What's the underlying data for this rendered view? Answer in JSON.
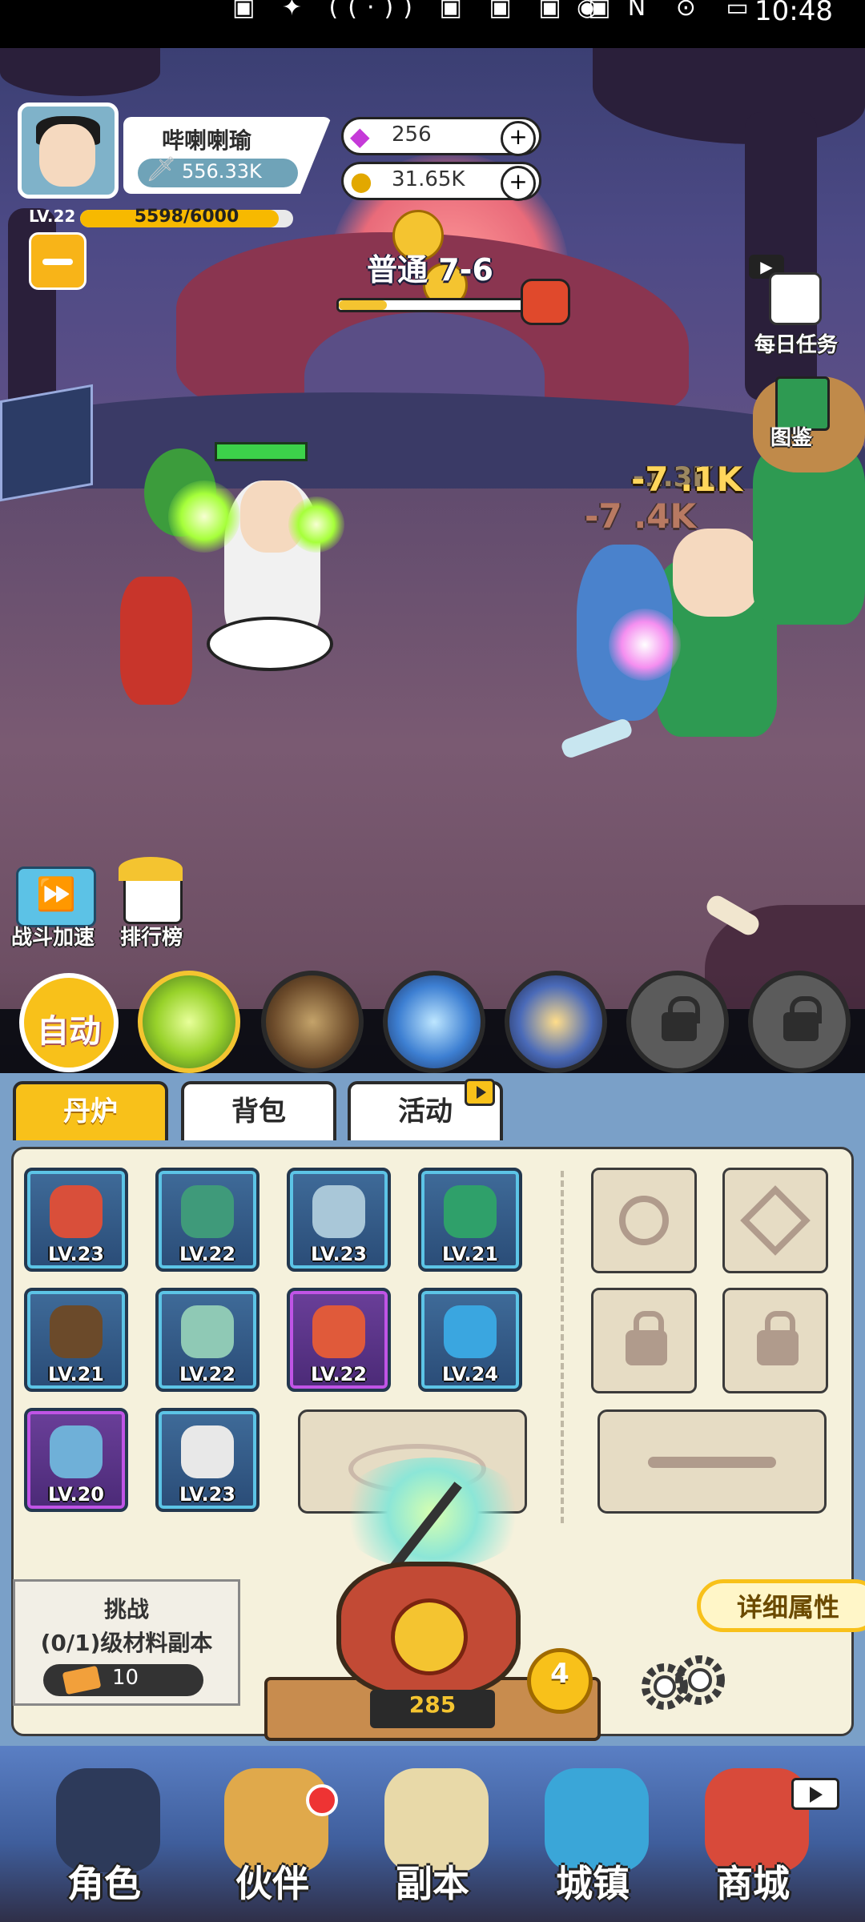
{
  "status_bar": {
    "time": "10:48",
    "left_icons": "▣ ✦ ((·)) ▣ ▣ ▣ ▣",
    "right_icons": "◉ N ⊙ ▭"
  },
  "player": {
    "name": "哔喇喇瑜",
    "power": "556.33K",
    "level": "LV.22",
    "xp": "5598/6000",
    "xp_fraction": 0.933
  },
  "currency": {
    "gems": "256",
    "coins": "31.65K",
    "plus": "+"
  },
  "stage": {
    "label": "普通 7-6",
    "progress_fraction": 0.25
  },
  "battle": {
    "damage_1": "-7 .1K",
    "damage_2": "-7 .4K",
    "damage_3": "-1.3K"
  },
  "side_buttons": {
    "daily_task": "每日任务",
    "codex": "图鉴",
    "battle_speed": "战斗加速",
    "leaderboard": "排行榜"
  },
  "skills": {
    "auto": "自动"
  },
  "tabs": [
    "丹炉",
    "背包",
    "活动"
  ],
  "equipment": [
    {
      "level": "LV.23",
      "rarity": "blue",
      "icon": "dagger-icon",
      "color": "#d94f3a"
    },
    {
      "level": "LV.22",
      "rarity": "blue",
      "icon": "armor-icon",
      "color": "#3f9a7a"
    },
    {
      "level": "LV.23",
      "rarity": "blue",
      "icon": "robe-icon",
      "color": "#a9c7d8"
    },
    {
      "level": "LV.21",
      "rarity": "blue",
      "icon": "dragon-orb-icon",
      "color": "#2fa06a"
    },
    {
      "level": "LV.21",
      "rarity": "blue",
      "icon": "staff-icon",
      "color": "#6b4a2a"
    },
    {
      "level": "LV.22",
      "rarity": "blue",
      "icon": "jade-disc-icon",
      "color": "#8fc9b5"
    },
    {
      "level": "LV.22",
      "rarity": "purple",
      "icon": "gourd-icon",
      "color": "#e05a3a"
    },
    {
      "level": "LV.24",
      "rarity": "blue",
      "icon": "water-orb-icon",
      "color": "#3aa6e0"
    },
    {
      "level": "LV.20",
      "rarity": "purple",
      "icon": "whip-icon",
      "color": "#6fb0d8"
    },
    {
      "level": "LV.23",
      "rarity": "blue",
      "icon": "boots-icon",
      "color": "#e8e8e8"
    }
  ],
  "challenge": {
    "title": "挑战",
    "subtitle": "(0/1)级材料副本",
    "tickets": "10"
  },
  "detail_button": "详细属性",
  "furnace": {
    "count": "285",
    "badge": "4"
  },
  "nav": [
    "角色",
    "伙伴",
    "副本",
    "城镇",
    "商城"
  ]
}
